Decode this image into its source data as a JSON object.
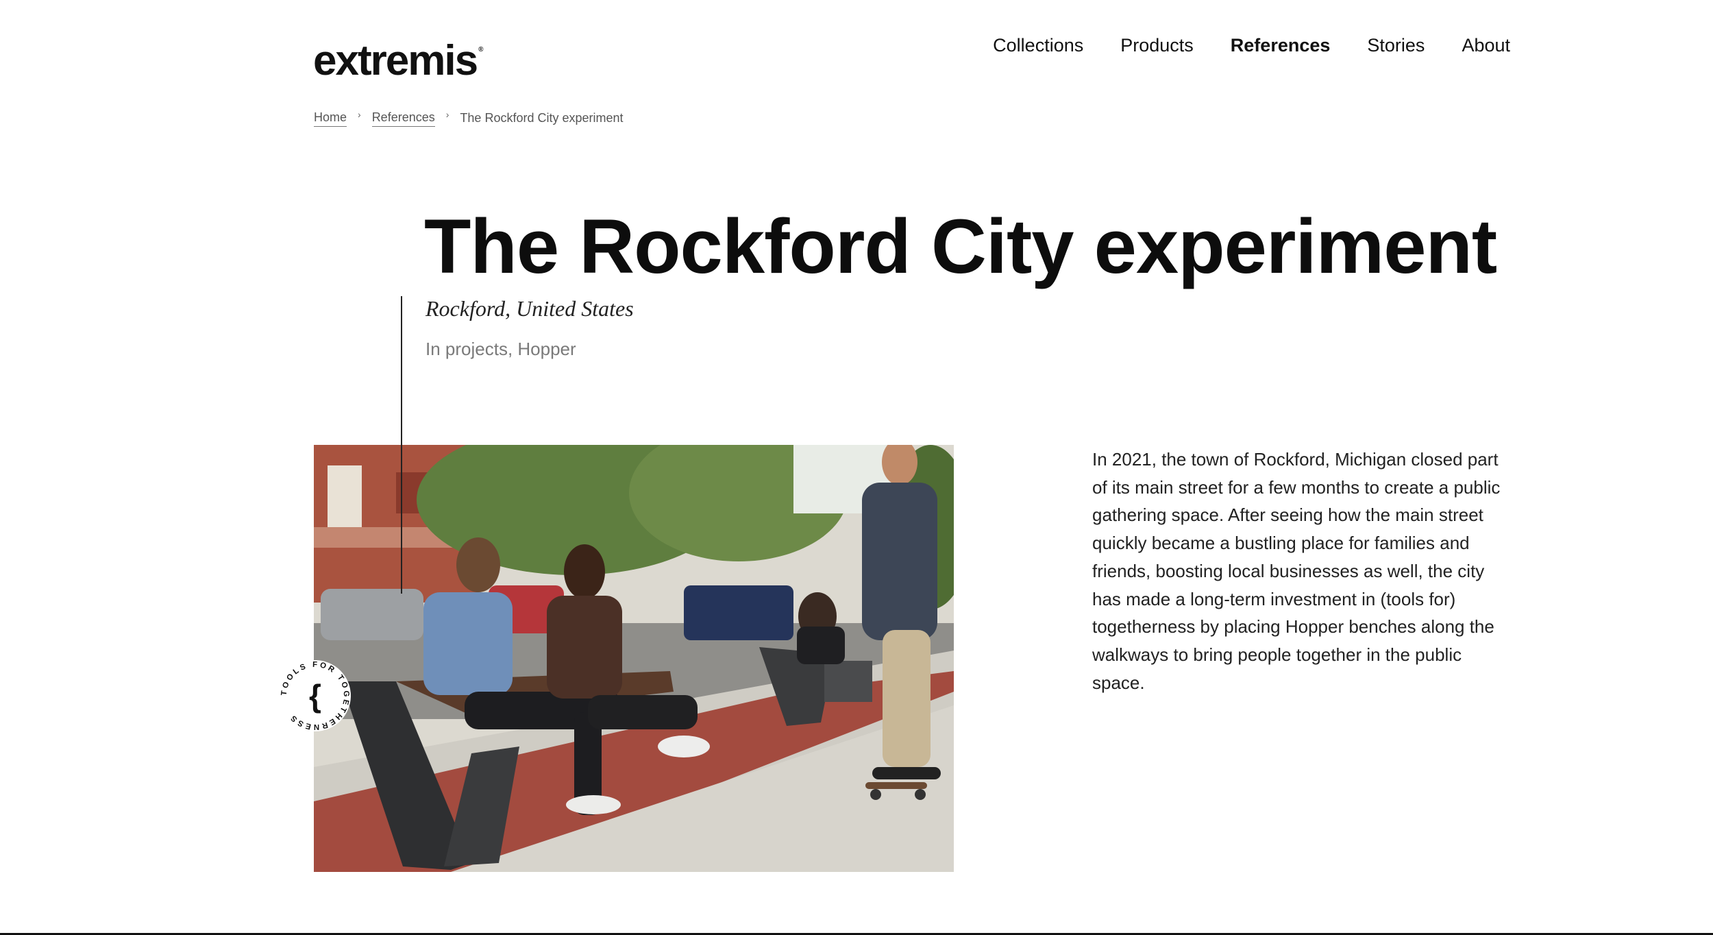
{
  "brand": {
    "logo": "extremis",
    "registered": "®"
  },
  "nav": {
    "items": [
      {
        "label": "Collections",
        "active": false
      },
      {
        "label": "Products",
        "active": false
      },
      {
        "label": "References",
        "active": true
      },
      {
        "label": "Stories",
        "active": false
      },
      {
        "label": "About",
        "active": false
      }
    ]
  },
  "breadcrumb": {
    "items": [
      "Home",
      "References"
    ],
    "current": "The Rockford City experiment"
  },
  "article": {
    "title": "The Rockford City experiment",
    "location": "Rockford, United States",
    "tags": "In projects, Hopper",
    "body": "In 2021, the town of Rockford, Michigan closed part of its main street for a few months to create a public gathering space. After seeing how the main street quickly became a bustling place for families and friends, boosting local businesses as well, the city has made a long-term investment in (tools for) togetherness by placing Hopper benches along the walkways to bring people together in the public space."
  },
  "badge": {
    "text": "TOOLS FOR TOGETHERNESS",
    "symbol": "{"
  },
  "colors": {
    "text": "#111111",
    "muted": "#7a7a7a",
    "background": "#ffffff"
  }
}
